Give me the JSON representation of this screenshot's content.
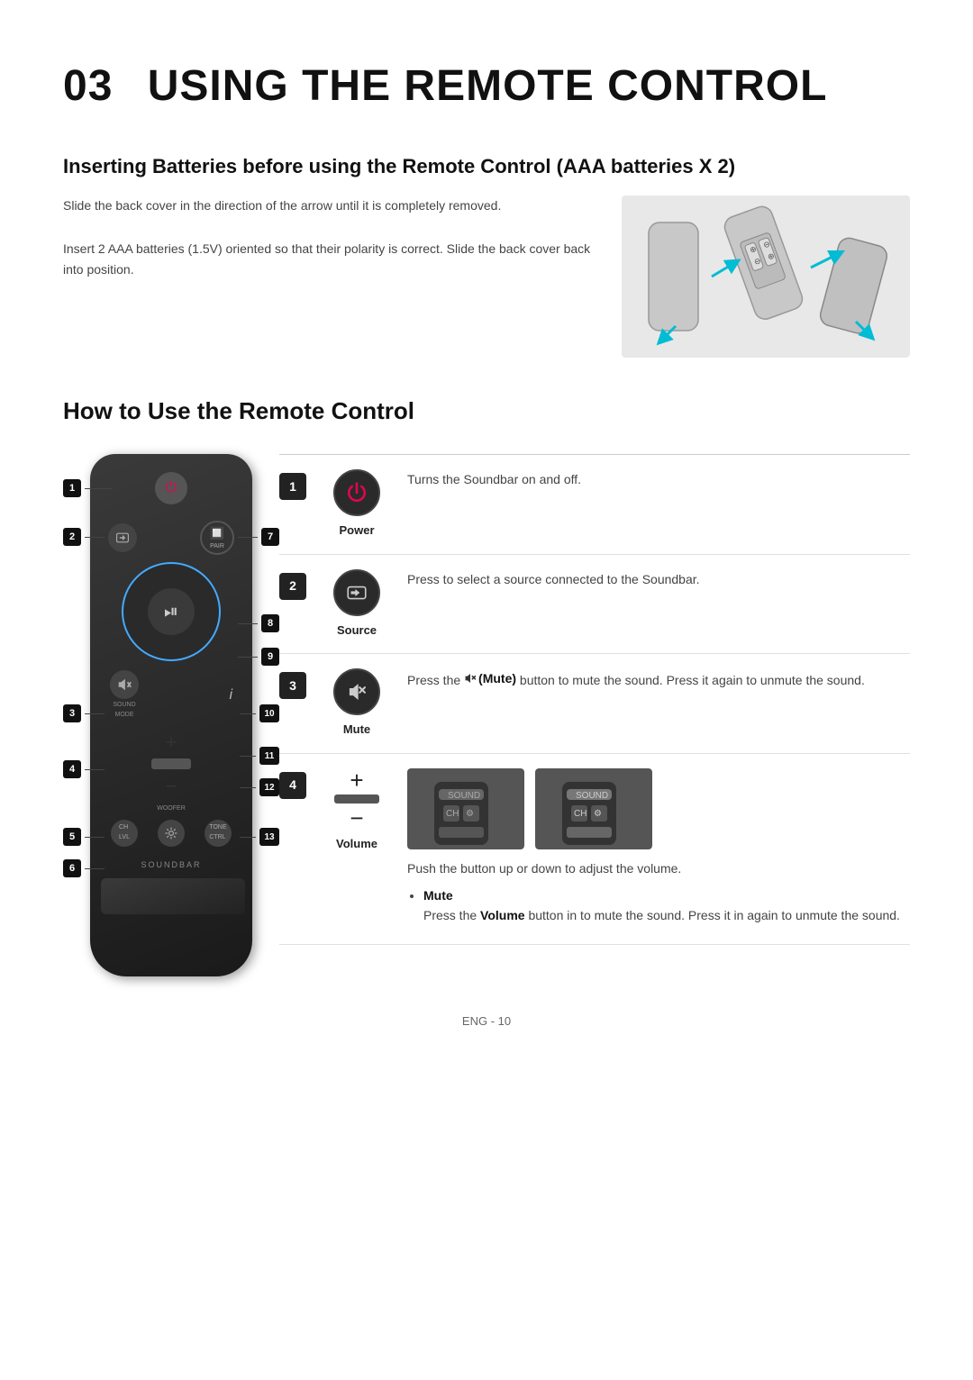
{
  "page": {
    "chapter": "03",
    "title": "USING THE REMOTE CONTROL"
  },
  "battery_section": {
    "heading": "Inserting Batteries before using the Remote Control (AAA batteries X 2)",
    "text1": "Slide the back cover in the direction of the arrow until it is completely removed.",
    "text2": "Insert 2 AAA batteries (1.5V) oriented so that their polarity is correct. Slide the back cover back into position."
  },
  "how_section": {
    "heading": "How to Use the Remote Control"
  },
  "remote_labels": [
    {
      "num": "1",
      "label": "Power"
    },
    {
      "num": "2",
      "label": "Source"
    },
    {
      "num": "3",
      "label": "Mute"
    },
    {
      "num": "4",
      "label": "Volume±"
    },
    {
      "num": "5",
      "label": "CH LEVEL"
    },
    {
      "num": "6",
      "label": "Soundbar"
    },
    {
      "num": "7",
      "label": "BT PAIR"
    },
    {
      "num": "8",
      "label": "Play/Pause"
    },
    {
      "num": "9",
      "label": "Ring"
    },
    {
      "num": "10",
      "label": "i / Sound Mode"
    },
    {
      "num": "11",
      "label": "Woofer +"
    },
    {
      "num": "12",
      "label": "Woofer −"
    },
    {
      "num": "13",
      "label": "Tone Control"
    }
  ],
  "descriptions": [
    {
      "num": "1",
      "icon_label": "Power",
      "icon_symbol": "⏻",
      "text": "Turns the Soundbar on and off."
    },
    {
      "num": "2",
      "icon_label": "Source",
      "icon_symbol": "⇒",
      "text": "Press to select a source connected to the Soundbar."
    },
    {
      "num": "3",
      "icon_label": "Mute",
      "icon_symbol": "🔇",
      "text_before_bold": "Press the ",
      "bold_text": "🔇 (Mute)",
      "text_after_bold": " button to mute the sound. Press it again to unmute the sound."
    },
    {
      "num": "4",
      "icon_label": "Volume",
      "icon_symbol": "+\n−",
      "text_intro": "Push the button up or down to adjust the volume.",
      "bullet_label": "Mute",
      "bullet_text": "Press the ",
      "bullet_bold": "Volume",
      "bullet_end": " button in to mute the sound. Press it in again to unmute the sound."
    }
  ],
  "footer": {
    "text": "ENG - 10"
  }
}
